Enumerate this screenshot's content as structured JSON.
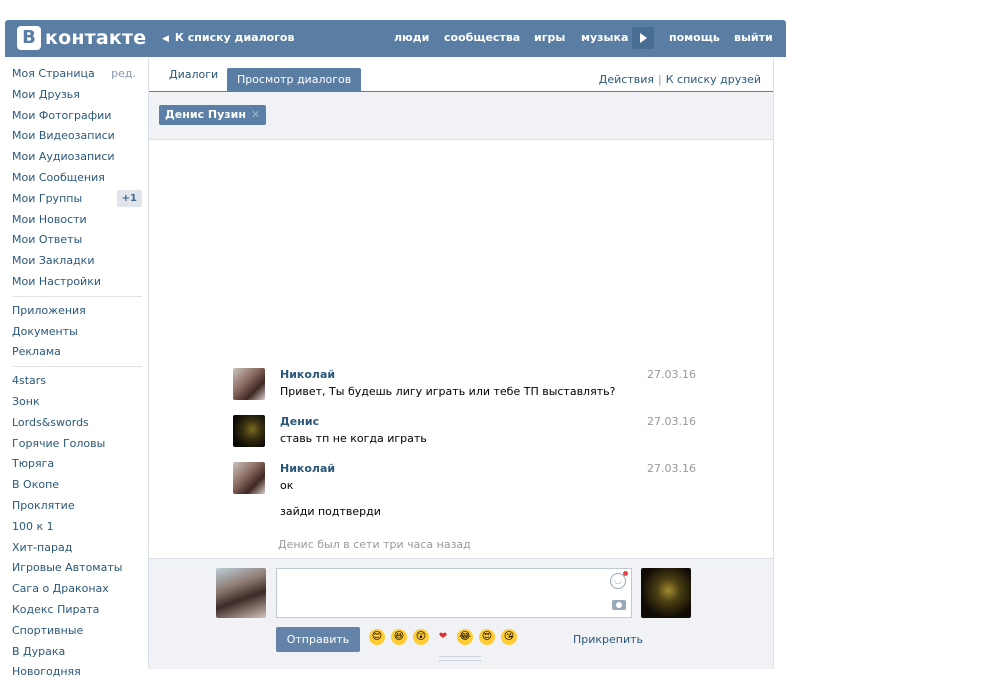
{
  "header": {
    "logo_letter": "В",
    "logo_text": "контакте",
    "back_link": "К списку диалогов",
    "nav": [
      "люди",
      "сообщества",
      "игры",
      "музыка",
      "помощь",
      "выйти"
    ]
  },
  "sidebar": {
    "edit_label": "ред.",
    "primary": [
      {
        "label": "Моя Страница"
      },
      {
        "label": "Мои Друзья"
      },
      {
        "label": "Мои Фотографии"
      },
      {
        "label": "Мои Видеозаписи"
      },
      {
        "label": "Мои Аудиозаписи"
      },
      {
        "label": "Мои Сообщения"
      },
      {
        "label": "Мои Группы",
        "badge": "+1"
      },
      {
        "label": "Мои Новости"
      },
      {
        "label": "Мои Ответы"
      },
      {
        "label": "Мои Закладки"
      },
      {
        "label": "Мои Настройки"
      }
    ],
    "secondary": [
      "Приложения",
      "Документы",
      "Реклама"
    ],
    "apps": [
      "4stars",
      "Зонк",
      "Lords&swords",
      "Горячие Головы",
      "Тюряга",
      "В Окопе",
      "Проклятие",
      "100 к 1",
      "Хит-парад",
      "Игровые Автоматы",
      "Сага о Драконах",
      "Кодекс Пирата",
      "Спортивные",
      "В Дурака",
      "Новогодняя"
    ]
  },
  "tabs": {
    "dialogs": "Диалоги",
    "view": "Просмотр диалогов",
    "actions": "Действия",
    "separator": "|",
    "friends_link": "К списку друзей"
  },
  "peer": {
    "name": "Денис Пузин"
  },
  "messages": [
    {
      "author": "Николай",
      "date": "27.03.16",
      "lines": [
        "Привет, Ты будешь лигу играть или тебе ТП выставлять?"
      ],
      "avatar": "nikolay"
    },
    {
      "author": "Денис",
      "date": "27.03.16",
      "lines": [
        "ставь тп не когда играть"
      ],
      "avatar": "denis"
    },
    {
      "author": "Николай",
      "date": "27.03.16",
      "lines": [
        "ок",
        "зайди подтверди"
      ],
      "avatar": "nikolay"
    }
  ],
  "status": "Денис был в сети три часа назад",
  "composer": {
    "send_label": "Отправить",
    "attach_label": "Прикрепить",
    "emojis": [
      "😊",
      "😆",
      "😲",
      "❤",
      "😂",
      "😍",
      "😘"
    ]
  },
  "colors": {
    "header_bg": "#597da3",
    "link": "#2b587a",
    "button": "#6383a8"
  }
}
